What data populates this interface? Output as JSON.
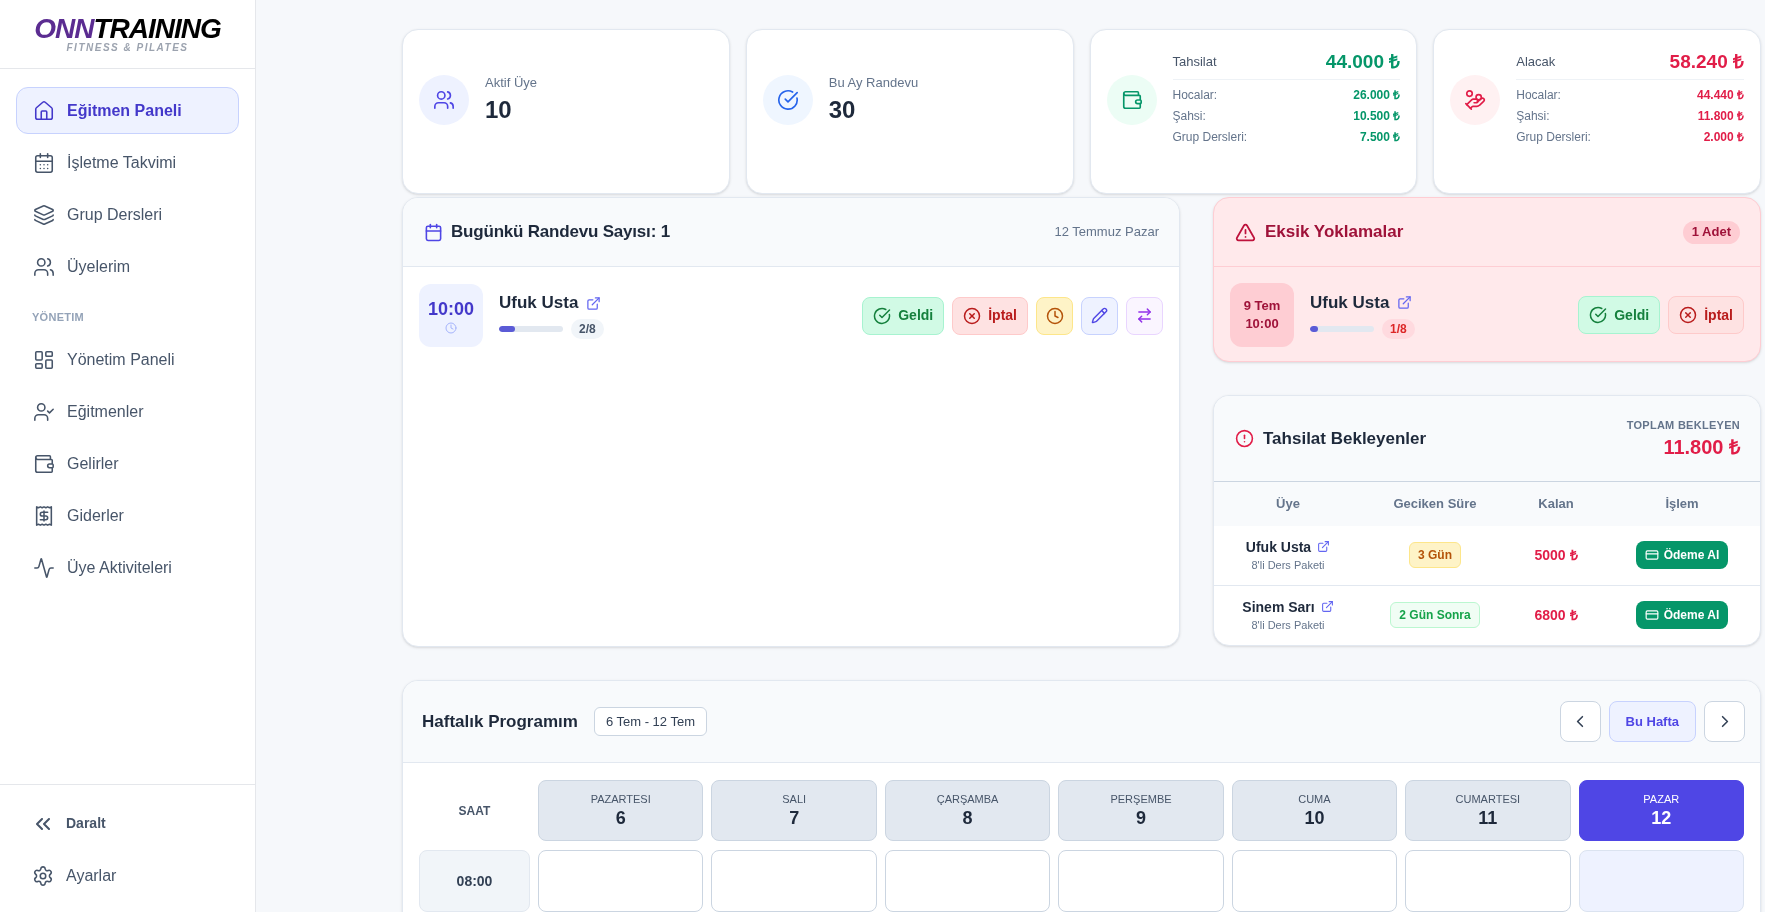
{
  "sidebar": {
    "logo": {
      "accent": "ONN",
      "name": "TRAINING",
      "tagline": "FITNESS & PILATES"
    },
    "sections": [
      {
        "items": [
          {
            "label": "Eğitmen Paneli",
            "selected": true
          },
          {
            "label": "İşletme Takvimi",
            "selected": false
          },
          {
            "label": "Grup Dersleri",
            "selected": false
          },
          {
            "label": "Üyelerim",
            "selected": false
          }
        ]
      },
      {
        "heading": "YÖNETIM",
        "items": [
          {
            "label": "Yönetim Paneli",
            "selected": false
          },
          {
            "label": "Eğitmenler",
            "selected": false
          },
          {
            "label": "Gelirler",
            "selected": false
          },
          {
            "label": "Giderler",
            "selected": false
          },
          {
            "label": "Üye Aktiviteleri",
            "selected": false
          }
        ]
      }
    ],
    "footer": [
      "Daralt",
      "Ayarlar"
    ]
  },
  "stats": [
    {
      "kind": "count",
      "label": "Aktif Üye",
      "value": "10"
    },
    {
      "kind": "count",
      "label": "Bu Ay Randevu",
      "value": "30"
    },
    {
      "kind": "money",
      "label": "Tahsilat",
      "total": "44.000 ₺",
      "color": "#059669",
      "breakdown": [
        {
          "label": "Hocalar:",
          "value": "26.000 ₺"
        },
        {
          "label": "Şahsi:",
          "value": "10.500 ₺"
        },
        {
          "label": "Grup Dersleri:",
          "value": "7.500 ₺"
        }
      ]
    },
    {
      "kind": "money",
      "label": "Alacak",
      "total": "58.240 ₺",
      "color": "#e11d48",
      "breakdown": [
        {
          "label": "Hocalar:",
          "value": "44.440 ₺"
        },
        {
          "label": "Şahsi:",
          "value": "11.800 ₺"
        },
        {
          "label": "Grup Dersleri:",
          "value": "2.000 ₺"
        }
      ]
    }
  ],
  "today": {
    "title": "Bugünkü Randevu Sayısı: 1",
    "date": "12 Temmuz Pazar",
    "appointments": [
      {
        "time": "10:00",
        "name": "Ufuk Usta",
        "level": 0.25,
        "progress": "2/8",
        "actions": [
          "Geldi",
          "İptal"
        ]
      }
    ]
  },
  "missing_attendance": {
    "title": "Eksik Yoklamalar",
    "count": "1 Adet",
    "items": [
      {
        "date": "9 Tem",
        "time": "10:00",
        "name": "Ufuk Usta",
        "level": 0.125,
        "progress": "1/8",
        "actions": [
          "Geldi",
          "İptal"
        ]
      }
    ]
  },
  "pending_payments": {
    "title": "Tahsilat Bekleyenler",
    "total_label": "TOPLAM BEKLEYEN",
    "total": "11.800 ₺",
    "columns": [
      "Üye",
      "Geciken Süre",
      "Kalan",
      "İşlem"
    ],
    "rows": [
      {
        "member": "Ufuk Usta",
        "package": "8'li Ders Paketi",
        "delay": "3 Gün",
        "overdue": true,
        "remaining": "5000 ₺",
        "action": "Ödeme Al"
      },
      {
        "member": "Sinem Sarı",
        "package": "8'li Ders Paketi",
        "delay": "2 Gün Sonra",
        "overdue": false,
        "remaining": "6800 ₺",
        "action": "Ödeme Al"
      }
    ]
  },
  "week": {
    "title": "Haftalık Programım",
    "range": "6 Tem - 12 Tem",
    "current_button": "Bu Hafta",
    "time_header": "SAAT",
    "days": [
      {
        "name": "PAZARTESI",
        "date": "6",
        "selected": false
      },
      {
        "name": "SALI",
        "date": "7",
        "selected": false
      },
      {
        "name": "ÇARŞAMBA",
        "date": "8",
        "selected": false
      },
      {
        "name": "PERŞEMBE",
        "date": "9",
        "selected": false
      },
      {
        "name": "CUMA",
        "date": "10",
        "selected": false
      },
      {
        "name": "CUMARTESI",
        "date": "11",
        "selected": false
      },
      {
        "name": "PAZAR",
        "date": "12",
        "selected": true
      }
    ],
    "time_slots": [
      "08:00"
    ]
  }
}
